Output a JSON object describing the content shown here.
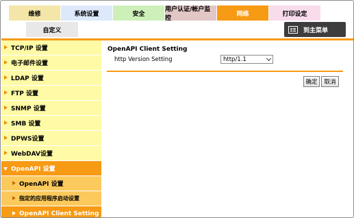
{
  "tabs": {
    "row1": [
      {
        "label": "维修"
      },
      {
        "label": "系统设置"
      },
      {
        "label": "安全"
      },
      {
        "label": "用户认证/帐户监控"
      },
      {
        "label": "网络"
      },
      {
        "label": "打印设定"
      }
    ],
    "custom": "自定义"
  },
  "menu_button": {
    "label": "到主菜单",
    "icon": "menu-icon"
  },
  "sidebar": {
    "items": [
      {
        "label": "TCP/IP 设置"
      },
      {
        "label": "电子邮件设置"
      },
      {
        "label": "LDAP 设置"
      },
      {
        "label": "FTP 设置"
      },
      {
        "label": "SNMP 设置"
      },
      {
        "label": "SMB 设置"
      },
      {
        "label": "DPWS设置"
      },
      {
        "label": "WebDAV设置"
      },
      {
        "label": "OpenAPI 设置"
      }
    ],
    "sub_items": [
      {
        "label": "OpenAPI 设置"
      },
      {
        "label": "指定的应用程序启动设置"
      },
      {
        "label": "OpenAPI Client Setting"
      }
    ]
  },
  "main": {
    "title": "OpenAPI Client Setting",
    "http_version_label": "http Version Setting",
    "http_version_value": "http/1.1",
    "ok_label": "确定",
    "cancel_label": "取消"
  },
  "colors": {
    "accent": "#f79a14",
    "sidebar_bg": "#fffaa6",
    "submenu_bg": "#fcc95c"
  }
}
